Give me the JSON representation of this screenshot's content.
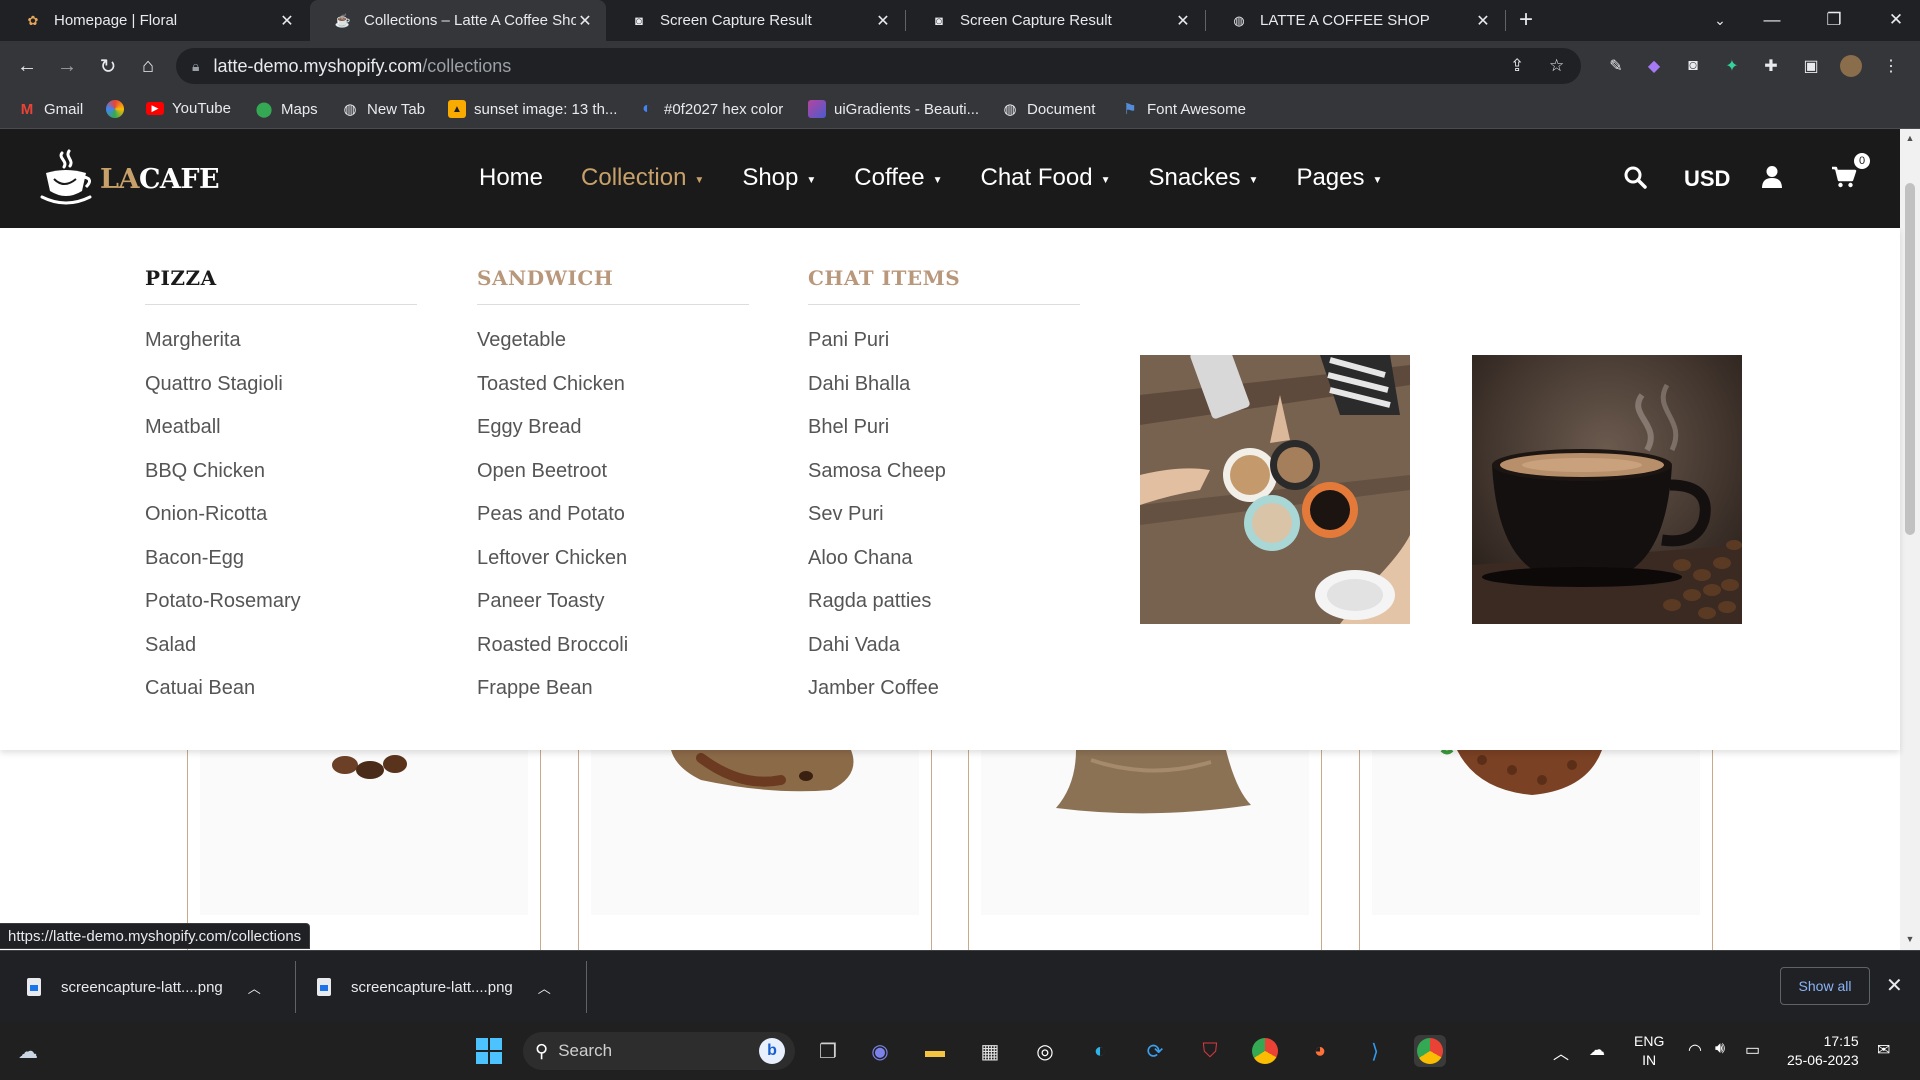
{
  "browser": {
    "tabs": [
      {
        "title": "Homepage | Floral",
        "active": false
      },
      {
        "title": "Collections – Latte A Coffee Shop",
        "active": true
      },
      {
        "title": "Screen Capture Result",
        "active": false
      },
      {
        "title": "Screen Capture Result",
        "active": false
      },
      {
        "title": "LATTE A COFFEE SHOP",
        "active": false
      }
    ],
    "new_tab": "+",
    "url_host": "latte-demo.myshopify.com",
    "url_path": "/collections",
    "bookmarks": [
      {
        "label": "Gmail",
        "icon": "gmail-icon",
        "color": "#ea4335"
      },
      {
        "label": "",
        "icon": "chrome-colorful-icon",
        "color": "#fbbc04"
      },
      {
        "label": "YouTube",
        "icon": "youtube-icon",
        "color": "#ff0000"
      },
      {
        "label": "Maps",
        "icon": "maps-pin-icon",
        "color": "#34a853"
      },
      {
        "label": "New Tab",
        "icon": "globe-icon",
        "color": "#e8eaed"
      },
      {
        "label": "sunset image: 13 th...",
        "icon": "image-icon",
        "color": "#f9ab00"
      },
      {
        "label": "#0f2027 hex color",
        "icon": "color-wheel-icon",
        "color": "#4285f4"
      },
      {
        "label": "uiGradients - Beauti...",
        "icon": "gradient-icon",
        "color": "#b6449e"
      },
      {
        "label": "Document",
        "icon": "globe-icon",
        "color": "#e8eaed"
      },
      {
        "label": "Font Awesome",
        "icon": "flag-icon",
        "color": "#538dd7"
      }
    ]
  },
  "site": {
    "logo": {
      "accent": "LA",
      "rest": "CAFE"
    },
    "nav": [
      {
        "label": "Home",
        "has_caret": false,
        "active": false
      },
      {
        "label": "Collection",
        "has_caret": true,
        "active": true
      },
      {
        "label": "Shop",
        "has_caret": true,
        "active": false
      },
      {
        "label": "Coffee",
        "has_caret": true,
        "active": false
      },
      {
        "label": "Chat Food",
        "has_caret": true,
        "active": false
      },
      {
        "label": "Snackes",
        "has_caret": true,
        "active": false
      },
      {
        "label": "Pages",
        "has_caret": true,
        "active": false
      }
    ],
    "currency": "USD",
    "cart_count": "0",
    "accent_color": "#c8a16a",
    "header_bg": "#1a1a1a"
  },
  "mega_menu": {
    "columns": [
      {
        "heading": "PIZZA",
        "style": "dark",
        "items": [
          "Margherita",
          "Quattro Stagioli",
          "Meatball",
          "BBQ Chicken",
          "Onion-Ricotta",
          "Bacon-Egg",
          "Potato-Rosemary",
          "Salad",
          "Catuai Bean"
        ]
      },
      {
        "heading": "SANDWICH",
        "style": "tan",
        "items": [
          "Vegetable",
          "Toasted Chicken",
          "Eggy Bread",
          "Open Beetroot",
          "Peas and Potato",
          "Leftover Chicken",
          "Paneer Toasty",
          "Roasted Broccoli",
          "Frappe Bean"
        ]
      },
      {
        "heading": "CHAT ITEMS",
        "style": "tan",
        "items": [
          "Pani Puri",
          "Dahi Bhalla",
          "Bhel Puri",
          "Samosa Cheep",
          "Sev Puri",
          "Aloo Chana",
          "Ragda patties",
          "Dahi Vada",
          "Jamber Coffee"
        ]
      }
    ],
    "promos": [
      "coffee-cups-toast-image",
      "steaming-coffee-cup-image"
    ]
  },
  "status_url": "https://latte-demo.myshopify.com/collections",
  "downloads": {
    "files": [
      "screencapture-latt....png",
      "screencapture-latt....png"
    ],
    "show_all": "Show all"
  },
  "taskbar": {
    "search_placeholder": "Search",
    "lang_line1": "ENG",
    "lang_line2": "IN",
    "time": "17:15",
    "date": "25-06-2023"
  }
}
